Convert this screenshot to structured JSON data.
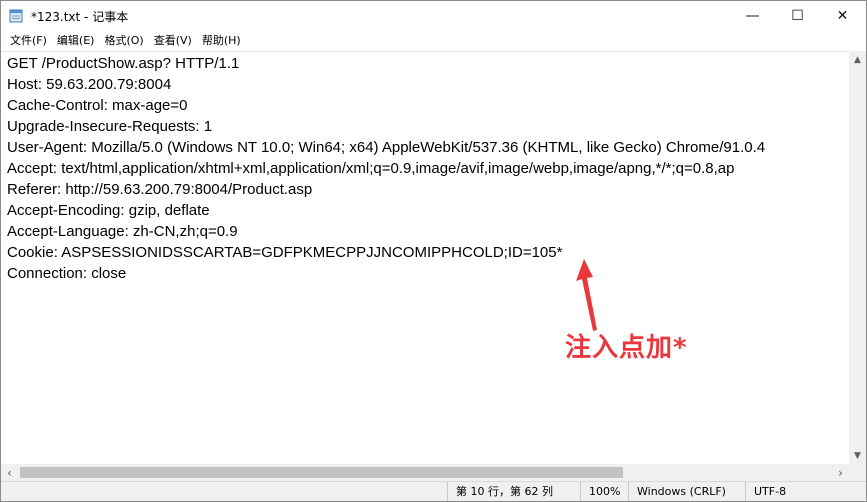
{
  "window": {
    "title": "*123.txt - 记事本",
    "minimize": "—",
    "maximize": "☐",
    "close": "✕"
  },
  "menu": [
    "文件(F)",
    "编辑(E)",
    "格式(O)",
    "查看(V)",
    "帮助(H)"
  ],
  "editor": {
    "lines": [
      "GET /ProductShow.asp? HTTP/1.1",
      "Host: 59.63.200.79:8004",
      "Cache-Control: max-age=0",
      "Upgrade-Insecure-Requests: 1",
      "User-Agent: Mozilla/5.0 (Windows NT 10.0; Win64; x64) AppleWebKit/537.36 (KHTML, like Gecko) Chrome/91.0.4",
      "Accept: text/html,application/xhtml+xml,application/xml;q=0.9,image/avif,image/webp,image/apng,*/*;q=0.8,ap",
      "Referer: http://59.63.200.79:8004/Product.asp",
      "Accept-Encoding: gzip, deflate",
      "Accept-Language: zh-CN,zh;q=0.9",
      "Cookie: ASPSESSIONIDSSCARTAB=GDFPKMECPPJJNCOMIPPHCOLD;ID=105*",
      "Connection: close"
    ]
  },
  "annotation": {
    "text": "注入点加*",
    "color": "#e8383d"
  },
  "scrollbar": {
    "up": "▲",
    "down": "▼",
    "left": "‹",
    "right": "›"
  },
  "status": {
    "position": "第 10 行，第 62 列",
    "zoom": "100%",
    "line_ending": "Windows (CRLF)",
    "encoding": "UTF-8"
  }
}
